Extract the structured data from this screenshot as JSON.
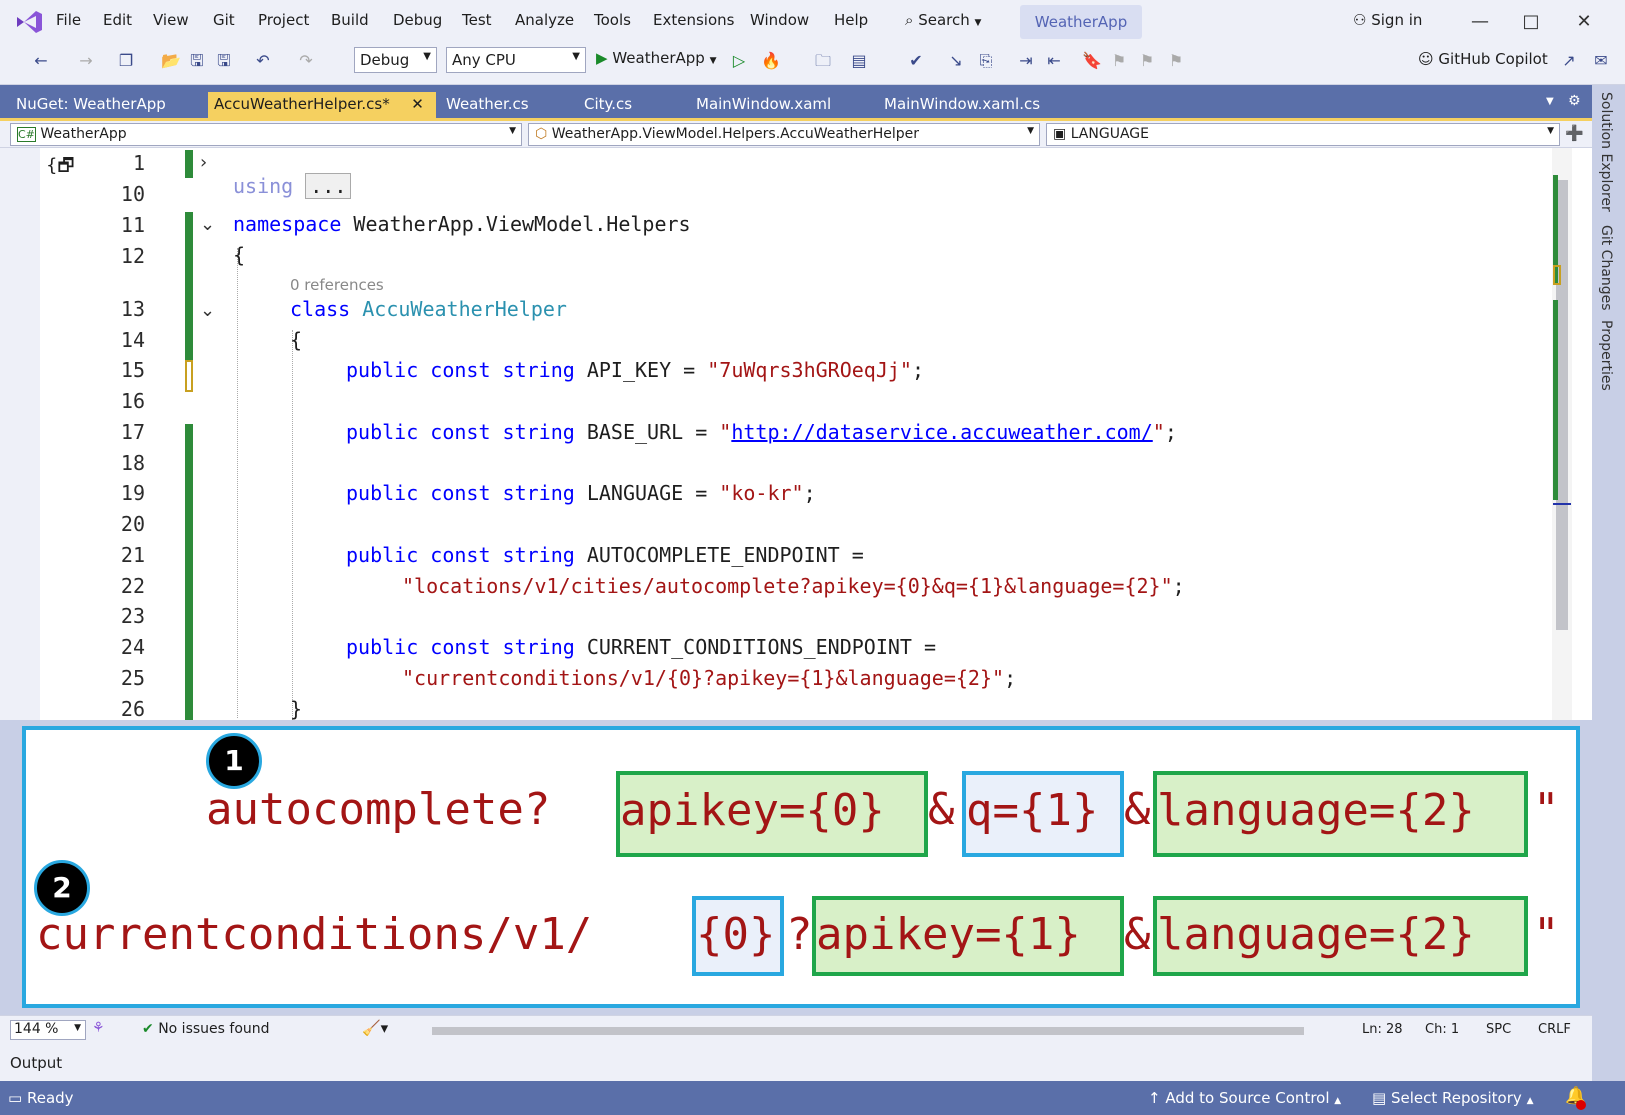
{
  "menu": [
    "File",
    "Edit",
    "View",
    "Git",
    "Project",
    "Build",
    "Debug",
    "Test",
    "Analyze",
    "Tools",
    "Extensions",
    "Window",
    "Help"
  ],
  "search_label": "Search",
  "project_name": "WeatherApp",
  "signin": "Sign in",
  "toolbar": {
    "config": "Debug",
    "platform": "Any CPU",
    "run_target": "WeatherApp",
    "copilot": "GitHub Copilot"
  },
  "tabs": [
    "NuGet: WeatherApp",
    "AccuWeatherHelper.cs*",
    "Weather.cs",
    "City.cs",
    "MainWindow.xaml",
    "MainWindow.xaml.cs"
  ],
  "right_dock": [
    "Solution Explorer",
    "Git Changes",
    "Properties"
  ],
  "nav": {
    "project": "WeatherApp",
    "type": "WeatherApp.ViewModel.Helpers.AccuWeatherHelper",
    "member": "LANGUAGE"
  },
  "code": {
    "using_kw": "using",
    "collapsed": "...",
    "ns_kw": "namespace",
    "ns_name": "WeatherApp.ViewModel.Helpers",
    "brace_open": "{",
    "codelens": "0 references",
    "class_kw": "class",
    "class_name": "AccuWeatherHelper",
    "brace_open2": "{",
    "modifiers": "public const string",
    "api_key_name": "API_KEY",
    "api_key_value": "\"7uWqrs3hGROeqJj\"",
    "base_url_name": "BASE_URL",
    "base_url_q1": "\"",
    "base_url_value": "http://dataservice.accuweather.com/",
    "base_url_q2": "\"",
    "language_name": "LANGUAGE",
    "language_value": "\"ko-kr\"",
    "auto_name": "AUTOCOMPLETE_ENDPOINT",
    "auto_value": "\"locations/v1/cities/autocomplete?apikey={0}&q={1}&language={2}\"",
    "cur_name": "CURRENT_CONDITIONS_ENDPOINT",
    "cur_value": "\"currentconditions/v1/{0}?apikey={1}&language={2}\"",
    "eq": " = ",
    "semi": ";",
    "close_brace": "}"
  },
  "line_numbers": [
    "1",
    "10",
    "11",
    "12",
    "13",
    "14",
    "15",
    "16",
    "17",
    "18",
    "19",
    "20",
    "21",
    "22",
    "23",
    "24",
    "25",
    "26"
  ],
  "callout": {
    "badge1": "1",
    "badge2": "2",
    "l1_prefix": "autocomplete?",
    "l1_p1": "apikey={0}",
    "l1_amp1": "&",
    "l1_p2": "q={1}",
    "l1_amp2": "&",
    "l1_p3": "language={2}",
    "l1_end": "\"",
    "l2_prefix": "currentconditions/v1/",
    "l2_p0": "{0}",
    "l2_q": "?",
    "l2_p1": "apikey={1}",
    "l2_amp": "&",
    "l2_p2": "language={2}",
    "l2_end": "\""
  },
  "editor_status": {
    "zoom": "144 %",
    "issues": "No issues found",
    "ln": "Ln: 28",
    "ch": "Ch: 1",
    "spc": "SPC",
    "crlf": "CRLF"
  },
  "output": "Output",
  "status": {
    "ready": "Ready",
    "add_source": "Add to Source Control",
    "select_repo": "Select Repository"
  },
  "colors": {
    "keyword": "#0000ff",
    "type": "#2b91af",
    "string": "#a31515",
    "callout_border": "#29a8e0",
    "highlight_green": "#1fa64a",
    "tab_active": "#f5d060",
    "chrome": "#5a6fa9"
  }
}
